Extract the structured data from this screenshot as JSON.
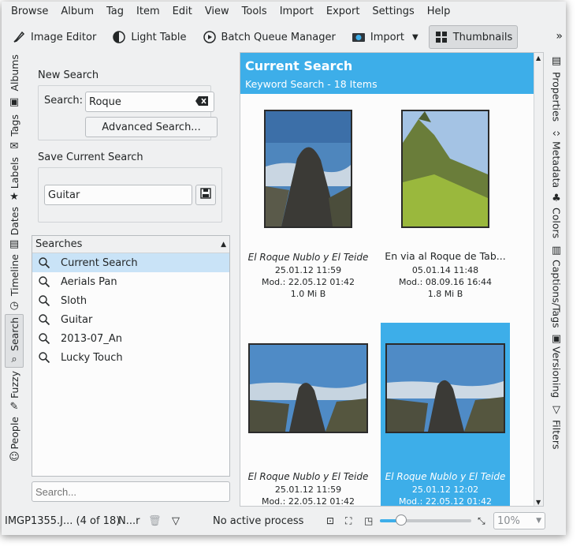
{
  "menubar": [
    "Browse",
    "Album",
    "Tag",
    "Item",
    "Edit",
    "View",
    "Tools",
    "Import",
    "Export",
    "Settings",
    "Help"
  ],
  "toolbar": {
    "image_editor": "Image Editor",
    "light_table": "Light Table",
    "batch_queue": "Batch Queue Manager",
    "import": "Import",
    "thumbnails": "Thumbnails",
    "more": "»"
  },
  "left_tabs": [
    "Albums",
    "Tags",
    "Labels",
    "Dates",
    "Timeline",
    "Search",
    "Fuzzy",
    "People"
  ],
  "right_tabs": [
    "Properties",
    "Metadata",
    "Colors",
    "Captions/Tags",
    "Versioning",
    "Filters"
  ],
  "search_panel": {
    "new_search_title": "New Search",
    "search_label": "Search:",
    "search_value": "Roque",
    "advanced_button": "Advanced Search...",
    "save_title": "Save Current Search",
    "save_value": "Guitar",
    "list_header": "Searches",
    "list_items": [
      "Current Search",
      "Aerials Pan",
      "Sloth",
      "Guitar",
      "2013-07_An",
      "Lucky Touch"
    ],
    "filter_placeholder": "Search..."
  },
  "content": {
    "title": "Current Search",
    "subtitle": "Keyword Search - 18 Items",
    "items": [
      {
        "title": "El Roque Nublo y El Teide",
        "date": "25.01.12 11:59",
        "mod": "Mod.: 22.05.12 01:42",
        "size": "1.0 Mi B",
        "italic": true
      },
      {
        "title": "En via al Roque de Tab...",
        "date": "05.01.14 11:48",
        "mod": "Mod.: 08.09.16 16:44",
        "size": "1.8 Mi B",
        "italic": false
      },
      {
        "title": "El Roque Nublo y El Teide",
        "date": "25.01.12 11:59",
        "mod": "Mod.: 22.05.12 01:42",
        "size": "",
        "italic": true
      },
      {
        "title": "El Roque Nublo y El Teide",
        "date": "25.01.12 12:02",
        "mod": "Mod.: 22.05.12 01:42",
        "size": "",
        "italic": true
      }
    ]
  },
  "status": {
    "file": "IMGP1355.J... (4 of 18)",
    "filter": "N...r",
    "process": "No active process",
    "zoom": "10%"
  },
  "colors": {
    "accent": "#3daee9",
    "selection": "#c9e3f7",
    "window_bg": "#eff0f1"
  }
}
